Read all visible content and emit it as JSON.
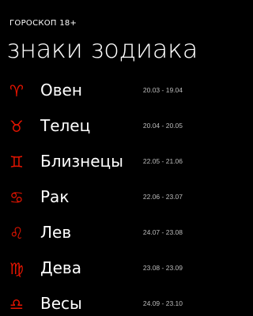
{
  "app": {
    "title": "ГОРОСКОП 18+"
  },
  "page": {
    "title": "знаки зодиака"
  },
  "theme": {
    "background": "#000000",
    "text": "#ffffff",
    "accent": "#e51400",
    "secondary_text": "#bcbcbc"
  },
  "signs": [
    {
      "name": "Овен",
      "dates": "20.03 - 19.04",
      "icon": "aries-icon",
      "glyph": "♈"
    },
    {
      "name": "Телец",
      "dates": "20.04 - 20.05",
      "icon": "taurus-icon",
      "glyph": "♉"
    },
    {
      "name": "Близнецы",
      "dates": "22.05 - 21.06",
      "icon": "gemini-icon",
      "glyph": "♊"
    },
    {
      "name": "Рак",
      "dates": "22.06 - 23.07",
      "icon": "cancer-icon",
      "glyph": "♋"
    },
    {
      "name": "Лев",
      "dates": "24.07 - 23.08",
      "icon": "leo-icon",
      "glyph": "♌"
    },
    {
      "name": "Дева",
      "dates": "23.08 - 23.09",
      "icon": "virgo-icon",
      "glyph": "♍"
    },
    {
      "name": "Весы",
      "dates": "24.09 - 23.10",
      "icon": "libra-icon",
      "glyph": "♎"
    }
  ]
}
